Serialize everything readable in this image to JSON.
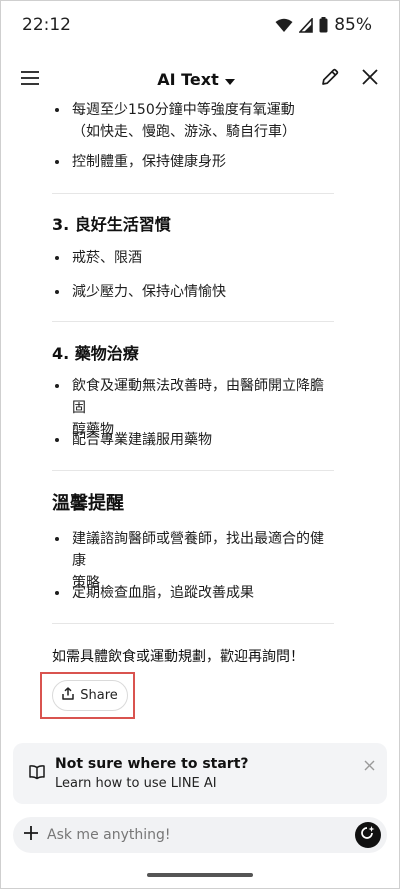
{
  "status_bar": {
    "time": "22:12",
    "battery": "85%"
  },
  "header": {
    "title": "AI Text"
  },
  "content": {
    "sec_exercise_item1_line1": "每週至少150分鐘中等強度有氧運動",
    "sec_exercise_item1_line2": "（如快走、慢跑、游泳、騎自行車）",
    "sec_exercise_item2": "控制體重，保持健康身形",
    "sec3_title": "3. 良好生活習慣",
    "sec3_item1": "戒菸、限酒",
    "sec3_item2": "減少壓力、保持心情愉快",
    "sec4_title": "4. 藥物治療",
    "sec4_item1_line1": "飲食及運動無法改善時，由醫師開立降膽固",
    "sec4_item1_line2": "醇藥物",
    "sec4_item2": "配合專業建議服用藥物",
    "reminder_title": "溫馨提醒",
    "reminder_item1_line1": "建議諮詢醫師或營養師，找出最適合的健康",
    "reminder_item1_line2": "策略",
    "reminder_item2": "定期檢查血脂，追蹤改善成果",
    "closing": "如需具體飲食或運動規劃，歡迎再詢問！"
  },
  "share": {
    "label": "Share"
  },
  "tip_card": {
    "title": "Not sure where to start?",
    "subtitle": "Learn how to use LINE AI"
  },
  "input": {
    "placeholder": "Ask me anything!"
  }
}
